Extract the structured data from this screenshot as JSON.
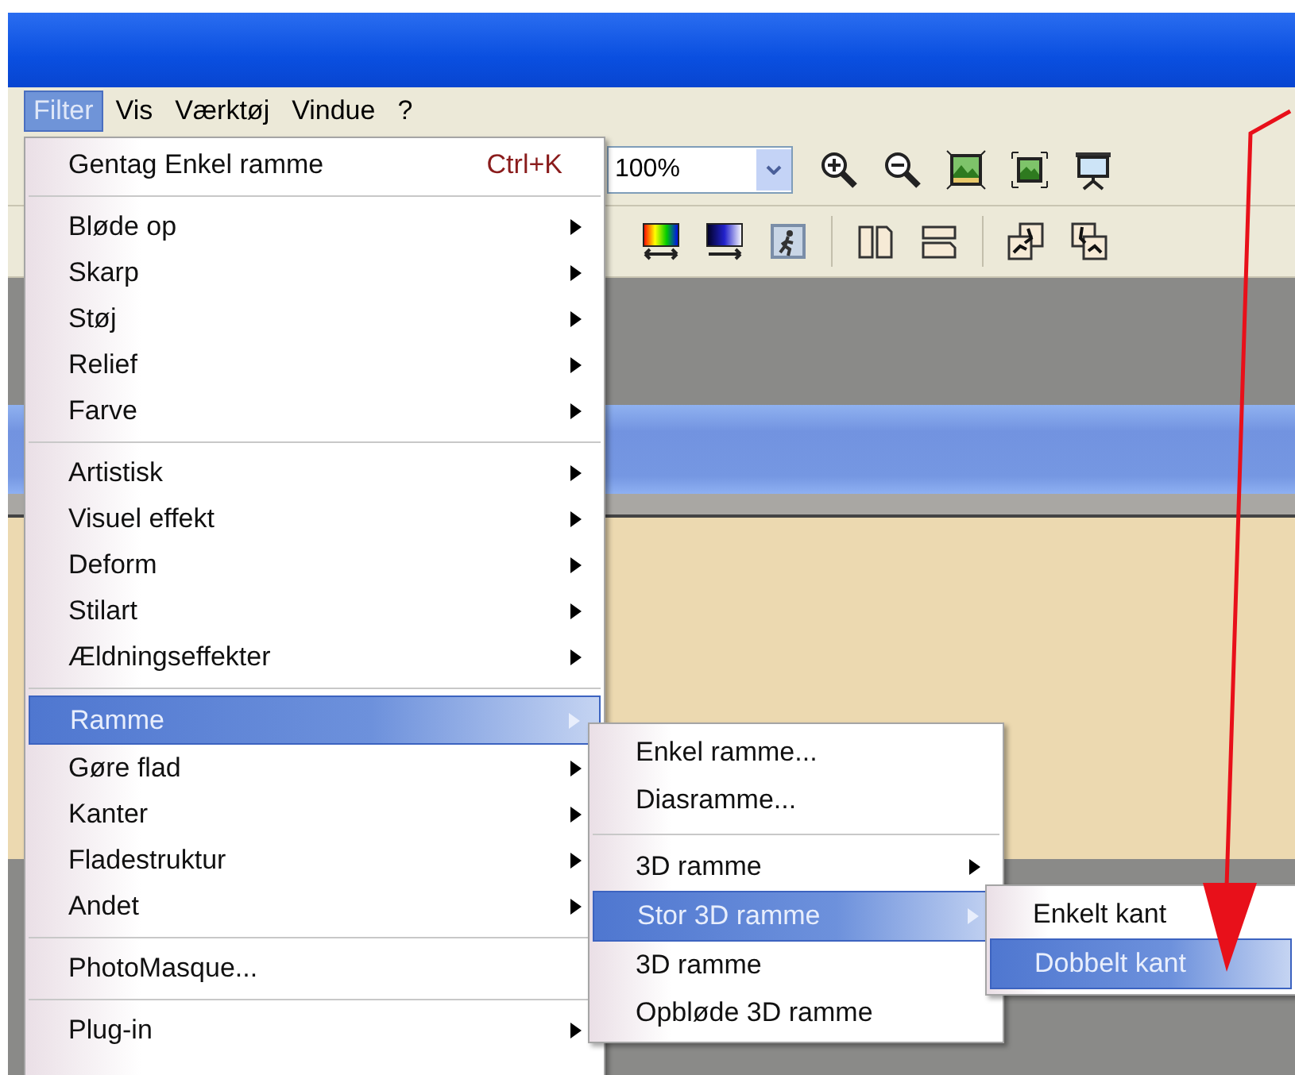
{
  "menu_bar": [
    {
      "label": "Filter",
      "selected": true
    },
    {
      "label": "Vis",
      "selected": false
    },
    {
      "label": "Værktøj",
      "selected": false
    },
    {
      "label": "Vindue",
      "selected": false
    },
    {
      "label": "?",
      "selected": false
    }
  ],
  "zoom_combo": {
    "value": "100%"
  },
  "filter_menu": [
    {
      "kind": "item",
      "label": "Gentag Enkel ramme",
      "shortcut": "Ctrl+K",
      "submenu": false,
      "selected": false
    },
    {
      "kind": "separator"
    },
    {
      "kind": "item",
      "label": "Bløde op",
      "submenu": true,
      "selected": false
    },
    {
      "kind": "item",
      "label": "Skarp",
      "submenu": true,
      "selected": false
    },
    {
      "kind": "item",
      "label": "Støj",
      "submenu": true,
      "selected": false
    },
    {
      "kind": "item",
      "label": "Relief",
      "submenu": true,
      "selected": false
    },
    {
      "kind": "item",
      "label": "Farve",
      "submenu": true,
      "selected": false
    },
    {
      "kind": "separator"
    },
    {
      "kind": "item",
      "label": "Artistisk",
      "submenu": true,
      "selected": false
    },
    {
      "kind": "item",
      "label": "Visuel effekt",
      "submenu": true,
      "selected": false
    },
    {
      "kind": "item",
      "label": "Deform",
      "submenu": true,
      "selected": false
    },
    {
      "kind": "item",
      "label": "Stilart",
      "submenu": true,
      "selected": false
    },
    {
      "kind": "item",
      "label": "Ældningseffekter",
      "submenu": true,
      "selected": false
    },
    {
      "kind": "separator"
    },
    {
      "kind": "item",
      "label": "Ramme",
      "submenu": true,
      "selected": true
    },
    {
      "kind": "item",
      "label": "Gøre flad",
      "submenu": true,
      "selected": false
    },
    {
      "kind": "item",
      "label": "Kanter",
      "submenu": true,
      "selected": false
    },
    {
      "kind": "item",
      "label": "Fladestruktur",
      "submenu": true,
      "selected": false
    },
    {
      "kind": "item",
      "label": "Andet",
      "submenu": true,
      "selected": false
    },
    {
      "kind": "separator"
    },
    {
      "kind": "item",
      "label": "PhotoMasque...",
      "submenu": false,
      "selected": false
    },
    {
      "kind": "separator"
    },
    {
      "kind": "item",
      "label": "Plug-in",
      "submenu": true,
      "selected": false
    }
  ],
  "ramme_submenu": [
    {
      "kind": "item",
      "label": "Enkel ramme...",
      "submenu": false,
      "selected": false
    },
    {
      "kind": "item",
      "label": "Diasramme...",
      "submenu": false,
      "selected": false
    },
    {
      "kind": "separator"
    },
    {
      "kind": "item",
      "label": "3D ramme",
      "submenu": true,
      "selected": false
    },
    {
      "kind": "item",
      "label": "Stor 3D ramme",
      "submenu": true,
      "selected": true
    },
    {
      "kind": "item",
      "label": "3D ramme",
      "submenu": false,
      "selected": false
    },
    {
      "kind": "item",
      "label": "Opbløde 3D ramme",
      "submenu": false,
      "selected": false
    }
  ],
  "stor_3d_submenu": [
    {
      "kind": "item",
      "label": "Enkelt kant",
      "submenu": false,
      "selected": false
    },
    {
      "kind": "item",
      "label": "Dobbelt kant",
      "submenu": false,
      "selected": true
    }
  ]
}
